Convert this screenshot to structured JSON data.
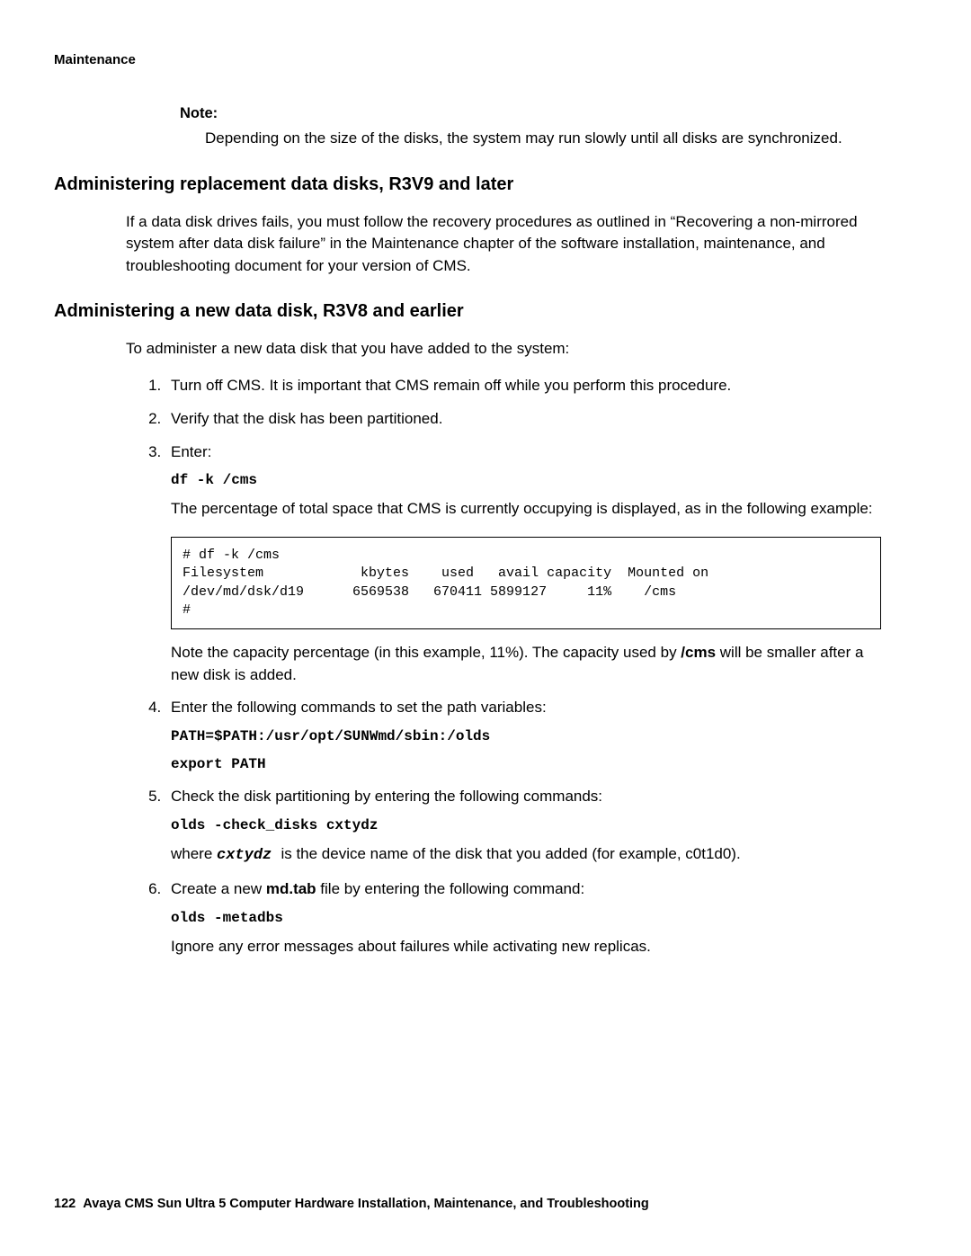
{
  "header": {
    "section": "Maintenance"
  },
  "note": {
    "label": "Note:",
    "body": "Depending on the size of the disks, the system may run slowly until all disks are synchronized."
  },
  "section1": {
    "title": "Administering replacement data disks, R3V9 and later",
    "body": "If a data disk drives fails, you must follow the recovery procedures as outlined in “Recovering a non-mirrored system after data disk failure” in the Maintenance chapter of the software installation, maintenance, and troubleshooting document for your version of CMS."
  },
  "section2": {
    "title": "Administering a new data disk, R3V8 and earlier",
    "intro": "To administer a new data disk that you have added to the system:",
    "steps": {
      "s1": "Turn off CMS. It is important that CMS remain off while you perform this procedure.",
      "s2": "Verify that the disk has been partitioned.",
      "s3": {
        "lead": "Enter:",
        "cmd": "df -k /cms",
        "after": "The percentage of total space that CMS is currently occupying is displayed, as in the following example:",
        "code": "# df -k /cms\nFilesystem            kbytes    used   avail capacity  Mounted on\n/dev/md/dsk/d19      6569538   670411 5899127     11%    /cms\n#",
        "note_a": "Note the capacity percentage (in this example, 11%). The capacity used by ",
        "note_cms": "/cms",
        "note_b": " will be smaller after a new disk is added."
      },
      "s4": {
        "lead": "Enter the following commands to set the path variables:",
        "cmd1": "PATH=$PATH:/usr/opt/SUNWmd/sbin:/olds",
        "cmd2": "export PATH"
      },
      "s5": {
        "lead": "Check the disk partitioning by entering the following commands:",
        "cmd": "olds -check_disks cxtydz",
        "where_a": "where ",
        "where_dev": " cxtydz ",
        "where_b": " is the device name of the disk that you added (for example, c0t1d0)."
      },
      "s6": {
        "lead_a": "Create a new ",
        "lead_file": "md.tab",
        "lead_b": " file by entering the following command:",
        "cmd": "olds -metadbs",
        "after": "Ignore any error messages about failures while activating new replicas."
      }
    }
  },
  "footer": {
    "page": "122",
    "title": "Avaya CMS Sun Ultra 5 Computer Hardware Installation, Maintenance, and Troubleshooting"
  }
}
